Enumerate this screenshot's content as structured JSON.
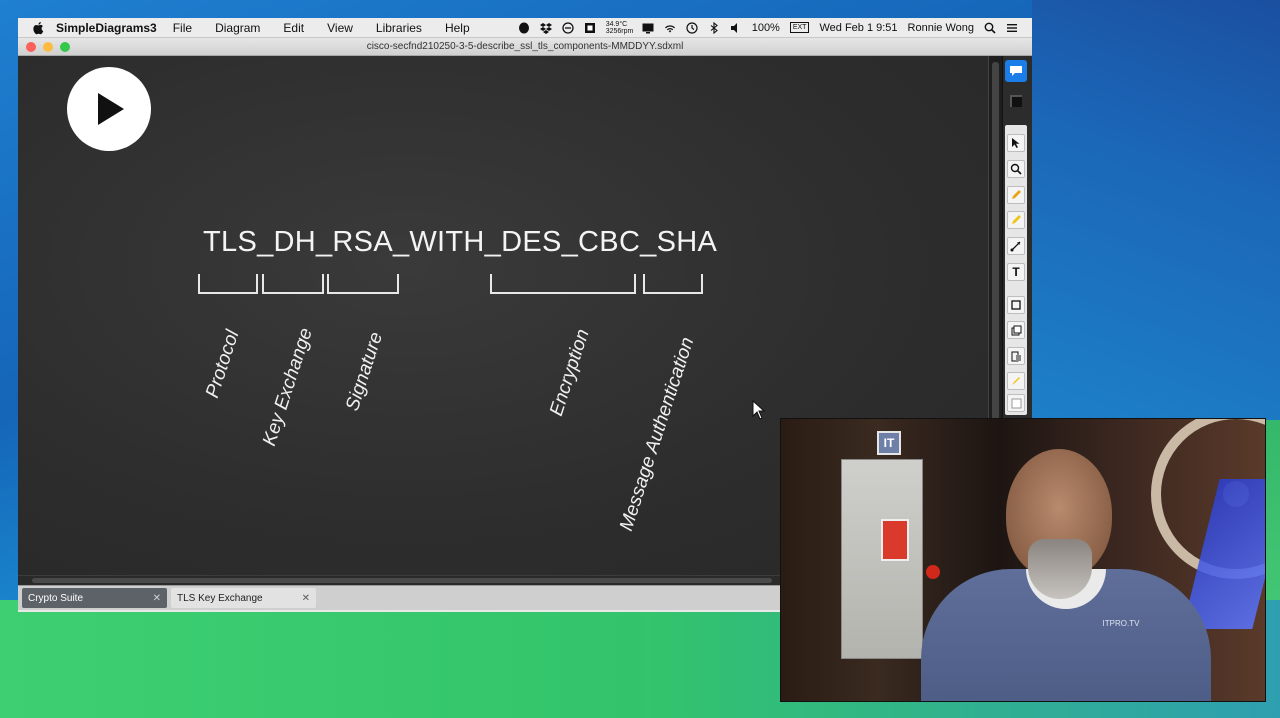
{
  "menubar": {
    "app_name": "SimpleDiagrams3",
    "items": [
      "File",
      "Diagram",
      "Edit",
      "View",
      "Libraries",
      "Help"
    ],
    "temp": "34.9°C",
    "fan": "3256rpm",
    "battery": "100%",
    "battery_badge": "EXT",
    "clock": "Wed Feb 1  9:51",
    "user": "Ronnie Wong"
  },
  "window": {
    "title": "cisco-secfnd210250-3-5-describe_ssl_tls_components-MMDDYY.sdxml"
  },
  "diagram": {
    "suite": "TLS_DH_RSA_WITH_DES_CBC_SHA",
    "labels": {
      "protocol": "Protocol",
      "key_exchange": "Key Exchange",
      "signature": "Signature",
      "encryption": "Encryption",
      "message_auth": "Message Authentication"
    }
  },
  "tabs": [
    {
      "label": "Crypto Suite",
      "active": true
    },
    {
      "label": "TLS Key Exchange",
      "active": false
    }
  ],
  "webcam": {
    "logo": "IT",
    "badge": "ITPRO.TV"
  }
}
